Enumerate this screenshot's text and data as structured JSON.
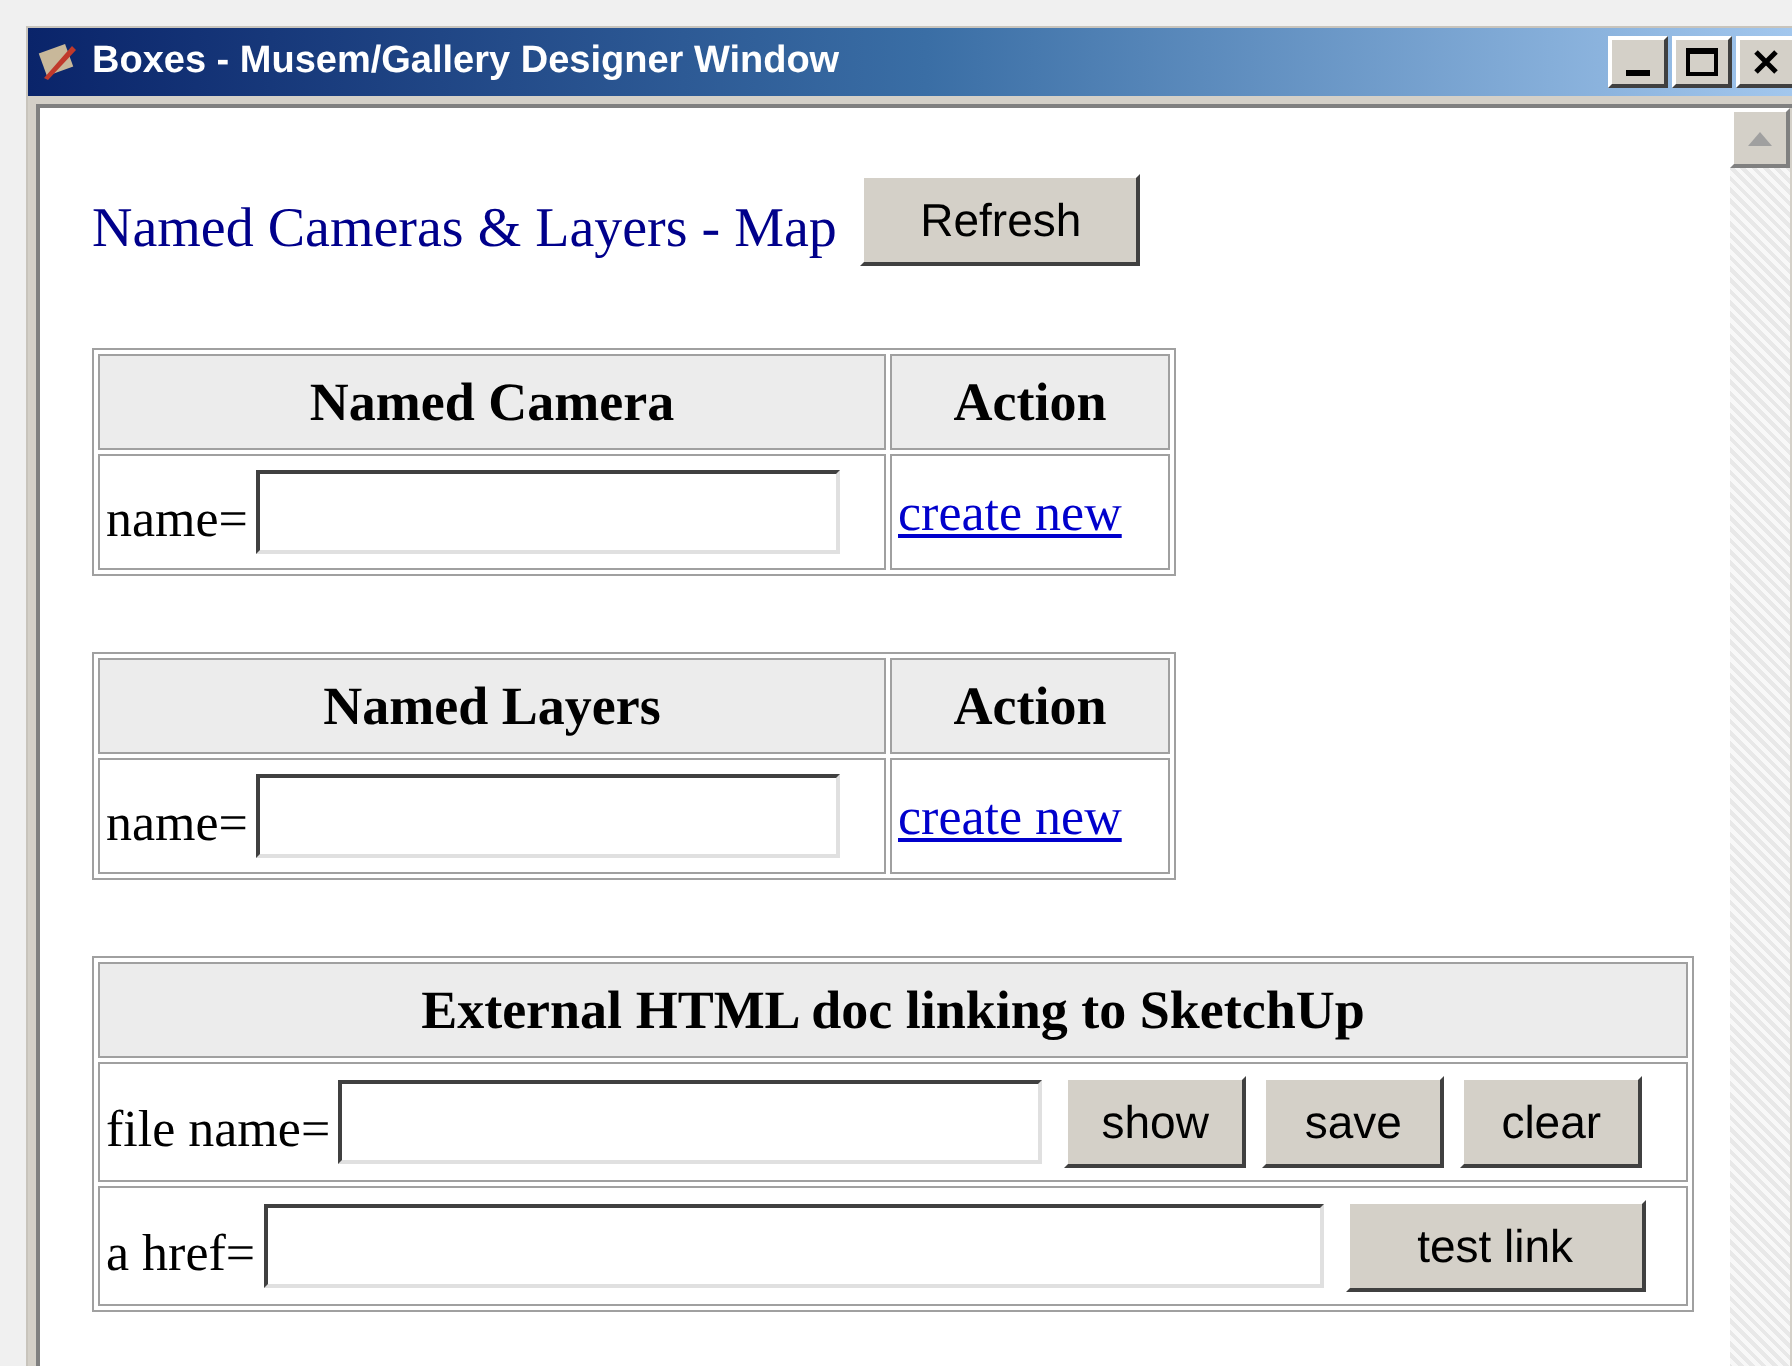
{
  "window": {
    "title": "Boxes - Musem/Gallery Designer Window"
  },
  "heading": "Named Cameras & Layers - Map",
  "refresh_button": "Refresh",
  "tables": [
    {
      "columns": [
        "Named Camera",
        "Action"
      ],
      "label": "name=",
      "link": "create new"
    },
    {
      "columns": [
        "Named Layers",
        "Action"
      ],
      "label": "name=",
      "link": "create new"
    }
  ],
  "external": {
    "title": "External HTML doc linking to SketchUp",
    "rows": [
      {
        "label": "file name=",
        "buttons": [
          "show",
          "save",
          "clear"
        ]
      },
      {
        "label": "a href=",
        "buttons": [
          "test link"
        ]
      }
    ]
  }
}
